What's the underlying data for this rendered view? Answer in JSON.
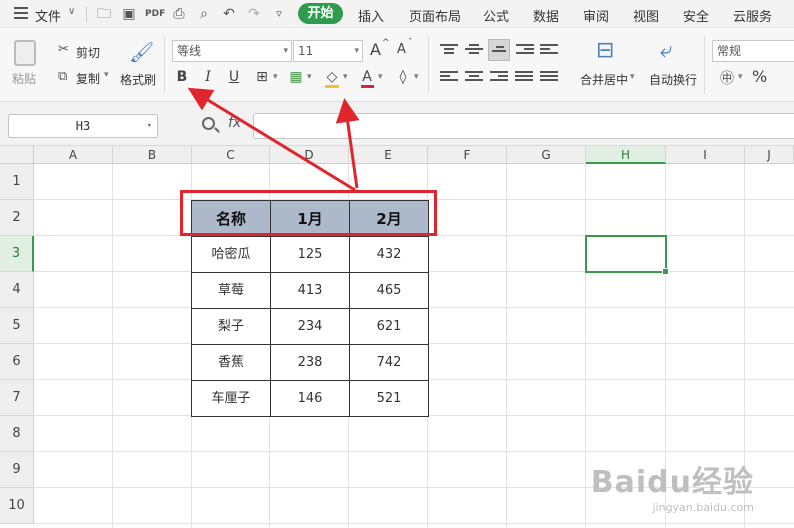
{
  "menubar": {
    "file_label": "文件",
    "tabs": [
      "开始",
      "插入",
      "页面布局",
      "公式",
      "数据",
      "审阅",
      "视图",
      "安全",
      "云服务"
    ],
    "active_tab": "开始"
  },
  "ribbon": {
    "paste_label": "粘贴",
    "cut_label": "剪切",
    "copy_label": "复制",
    "format_painter_label": "格式刷",
    "font_name": "等线",
    "font_size": "11",
    "merge_center_label": "合并居中",
    "wrap_text_label": "自动换行",
    "number_format": "常规",
    "bold_label": "B",
    "italic_label": "I",
    "underline_label": "U",
    "grow_font_label": "A",
    "shrink_font_label": "A",
    "font_color_label": "A",
    "percent_label": "%"
  },
  "formula_bar": {
    "name_box": "H3",
    "fx_label": "fx",
    "content": ""
  },
  "grid": {
    "columns": [
      "A",
      "B",
      "C",
      "D",
      "E",
      "F",
      "G",
      "H",
      "I",
      "J"
    ],
    "rows": [
      "1",
      "2",
      "3",
      "4",
      "5",
      "6",
      "7",
      "8",
      "9",
      "10"
    ],
    "selected_column": "H",
    "selected_row": "3",
    "table_header": [
      "名称",
      "1月",
      "2月"
    ],
    "table_rows": [
      [
        "哈密瓜",
        "125",
        "432"
      ],
      [
        "草莓",
        "413",
        "465"
      ],
      [
        "梨子",
        "234",
        "621"
      ],
      [
        "香蕉",
        "238",
        "742"
      ],
      [
        "车厘子",
        "146",
        "521"
      ]
    ],
    "header_fill_color": "#adb9ca",
    "selection_color": "#3a9a4b",
    "annotation_color": "#e0262c"
  },
  "watermark": {
    "logo": "Baidu经验",
    "url": "jingyan.baidu.com"
  }
}
